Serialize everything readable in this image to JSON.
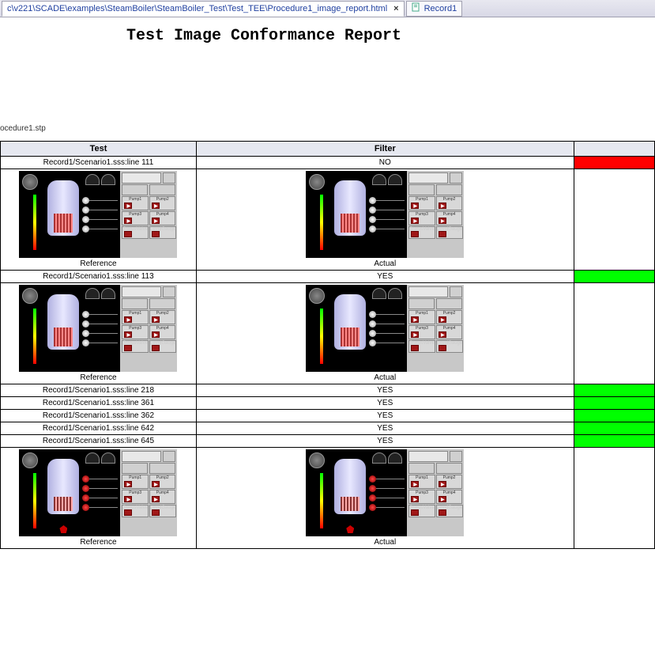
{
  "tabs": [
    {
      "label": "c\\v221\\SCADE\\examples\\SteamBoiler\\SteamBoiler_Test\\Test_TEE\\Procedure1_image_report.html",
      "active": true,
      "closable": true
    },
    {
      "label": "Record1",
      "active": false,
      "closable": false
    }
  ],
  "title": "Test Image Conformance Report",
  "subpath": "ocedure1.stp",
  "columns": {
    "test": "Test",
    "filter": "Filter"
  },
  "captions": {
    "reference": "Reference",
    "actual": "Actual"
  },
  "rows": [
    {
      "test": "Record1/Scenario1.sss:line 111",
      "filter": "NO",
      "status": "fail",
      "images": true
    },
    {
      "test": "Record1/Scenario1.sss:line 113",
      "filter": "YES",
      "status": "pass",
      "images": true
    },
    {
      "test": "Record1/Scenario1.sss:line 218",
      "filter": "YES",
      "status": "pass",
      "images": false
    },
    {
      "test": "Record1/Scenario1.sss:line 361",
      "filter": "YES",
      "status": "pass",
      "images": false
    },
    {
      "test": "Record1/Scenario1.sss:line 362",
      "filter": "YES",
      "status": "pass",
      "images": false
    },
    {
      "test": "Record1/Scenario1.sss:line 642",
      "filter": "YES",
      "status": "pass",
      "images": false
    },
    {
      "test": "Record1/Scenario1.sss:line 645",
      "filter": "YES",
      "status": "pass",
      "images": true,
      "variant": 2
    }
  ],
  "thumb": {
    "pumps": [
      "Pump1",
      "Pump2",
      "Pump3",
      "Pump4"
    ],
    "status_labels": [
      "StatusValve",
      "LevelGauge"
    ]
  }
}
